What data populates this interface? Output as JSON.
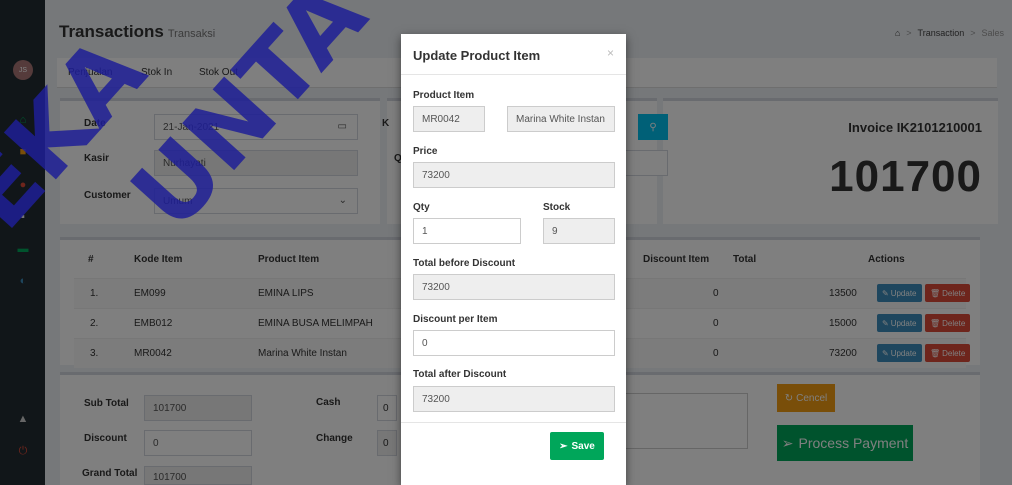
{
  "page": {
    "title": "Transactions",
    "subtitle": "Transaksi",
    "breadcrumb": [
      "Transaction",
      "Sales"
    ]
  },
  "tabs": [
    "Penjualan",
    "Stok In",
    "Stok Out"
  ],
  "form": {
    "date_label": "Date",
    "date_value": "21-Jan-2021",
    "cashier_label": "Kasir",
    "cashier_value": "Nurhayati",
    "customer_label": "Customer",
    "customer_value": "Umum",
    "k_label": "K",
    "q_label": "Q"
  },
  "invoice": {
    "label": "Invoice IK2101210001",
    "total": "101700"
  },
  "table": {
    "headers": [
      "#",
      "Kode Item",
      "Product Item",
      "Discount Item",
      "Total",
      "Actions"
    ],
    "rows": [
      {
        "no": "1.",
        "code": "EM099",
        "name": "EMINA LIPS",
        "discount": "0",
        "total": "13500"
      },
      {
        "no": "2.",
        "code": "EMB012",
        "name": "EMINA BUSA MELIMPAH",
        "discount": "0",
        "total": "15000"
      },
      {
        "no": "3.",
        "code": "MR0042",
        "name": "Marina White Instan",
        "discount": "0",
        "total": "73200"
      }
    ],
    "update_label": "Update",
    "delete_label": "Delete"
  },
  "summary": {
    "subtotal_label": "Sub Total",
    "subtotal_value": "101700",
    "discount_label": "Discount",
    "discount_value": "0",
    "grand_total_label": "Grand Total",
    "grand_total_value": "101700",
    "cash_label": "Cash",
    "cash_value": "0",
    "change_label": "Change",
    "change_value": "0",
    "cancel_label": "Cencel",
    "process_label": "Process Payment"
  },
  "modal": {
    "title": "Update Product Item",
    "close": "×",
    "product_label": "Product Item",
    "product_code": "MR0042",
    "product_name": "Marina White Instan",
    "price_label": "Price",
    "price_value": "73200",
    "qty_label": "Qty",
    "qty_value": "1",
    "stock_label": "Stock",
    "stock_value": "9",
    "total_before_label": "Total before Discount",
    "total_before_value": "73200",
    "discount_label": "Discount per Item",
    "discount_value": "0",
    "total_after_label": "Total after Discount",
    "total_after_value": "73200",
    "save_label": "Save"
  },
  "watermark": "EKA UNTA",
  "colors": {
    "sidebar": "#222d32",
    "primary": "#3c8dbc",
    "danger": "#dd4b39",
    "success": "#00a65a",
    "warning": "#f39c12",
    "info": "#00c0ef"
  }
}
